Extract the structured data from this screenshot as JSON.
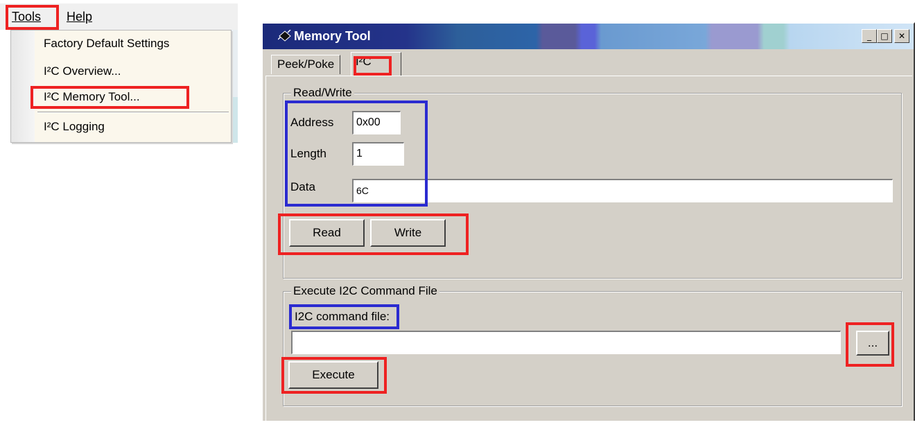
{
  "menubar": {
    "tools_label": "Tools",
    "help_label": "Help"
  },
  "tools_menu": {
    "items": [
      {
        "label": "Factory Default Settings"
      },
      {
        "label": "I²C Overview..."
      },
      {
        "label": "I²C Memory Tool..."
      },
      {
        "label": "I²C Logging"
      }
    ]
  },
  "window": {
    "title": "Memory Tool",
    "icon": "chip-icon",
    "controls": {
      "minimize": "_",
      "maximize": "□",
      "close": "✕"
    },
    "tabs": [
      {
        "label": "Peek/Poke"
      },
      {
        "label": "I²C"
      }
    ]
  },
  "read_write": {
    "group_title": "Read/Write",
    "address_label": "Address",
    "address_value": "0x00",
    "length_label": "Length",
    "length_value": "1",
    "data_label": "Data",
    "data_value": "6C",
    "read_button": "Read",
    "write_button": "Write"
  },
  "execute": {
    "group_title": "Execute I2C Command File",
    "file_label": "I2C command file:",
    "file_value": "",
    "browse_button": "...",
    "execute_button": "Execute"
  },
  "colors": {
    "highlight_red": "#ee2222",
    "highlight_blue": "#2b2bd0",
    "window_face": "#d4d0c8"
  }
}
